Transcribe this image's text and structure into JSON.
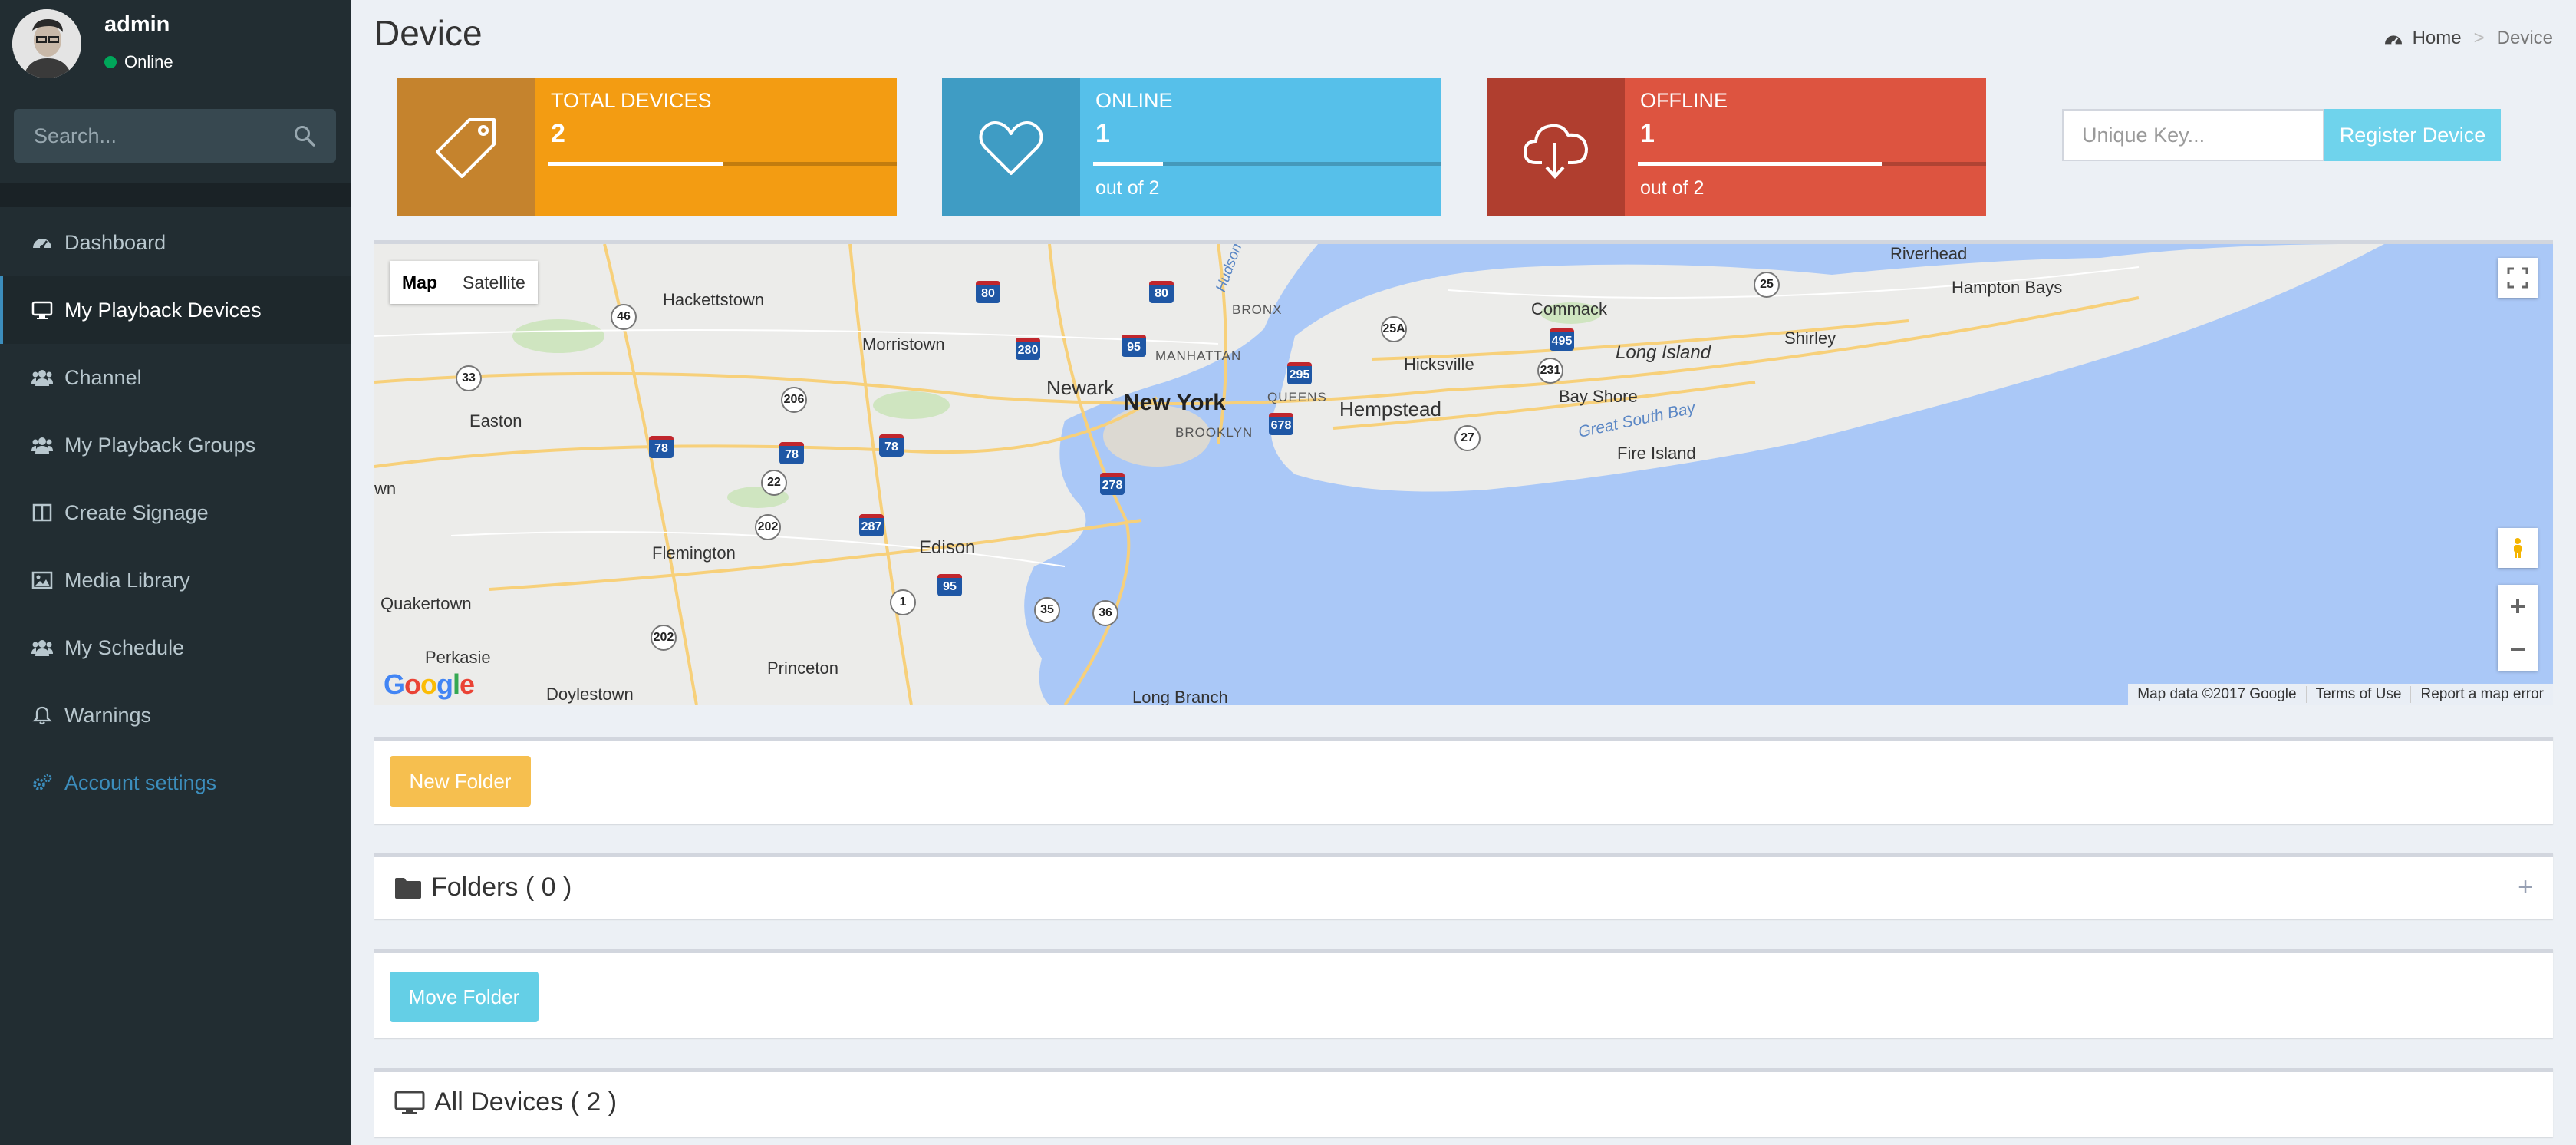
{
  "user": {
    "name": "admin",
    "status": "Online"
  },
  "search": {
    "placeholder": "Search..."
  },
  "nav": [
    {
      "label": "Dashboard",
      "icon": "dashboard-icon"
    },
    {
      "label": "My Playback Devices",
      "icon": "desktop-icon",
      "active": true
    },
    {
      "label": "Channel",
      "icon": "users-icon"
    },
    {
      "label": "My Playback Groups",
      "icon": "users-icon"
    },
    {
      "label": "Create Signage",
      "icon": "columns-icon"
    },
    {
      "label": "Media Library",
      "icon": "image-icon"
    },
    {
      "label": "My Schedule",
      "icon": "users-icon"
    },
    {
      "label": "Warnings",
      "icon": "bell-icon"
    },
    {
      "label": "Account settings",
      "icon": "gears-icon"
    }
  ],
  "page": {
    "title": "Device"
  },
  "breadcrumb": {
    "home": "Home",
    "current": "Device"
  },
  "stats": {
    "total": {
      "label": "TOTAL DEVICES",
      "value": "2",
      "progress": 0.5,
      "color": "#f39c12",
      "icon_bg": "#c5832d"
    },
    "online": {
      "label": "ONLINE",
      "value": "1",
      "sub": "out of 2",
      "progress": 0.2,
      "color": "#56c0ea",
      "icon_bg": "#3f9cc4"
    },
    "offline": {
      "label": "OFFLINE",
      "value": "1",
      "sub": "out of 2",
      "progress": 0.7,
      "color": "#dd5440",
      "icon_bg": "#b03e2f"
    }
  },
  "register": {
    "placeholder": "Unique Key...",
    "button": "Register Device"
  },
  "map": {
    "type_map": "Map",
    "type_satellite": "Satellite",
    "footer": [
      "Map data ©2017 Google",
      "Terms of Use",
      "Report a map error"
    ],
    "logo": "Google",
    "places": {
      "hackettstown": "Hackettstown",
      "morristown": "Morristown",
      "newark": "Newark",
      "newyork": "New York",
      "manhattan": "MANHATTAN",
      "bronx": "BRONX",
      "queens": "QUEENS",
      "brooklyn": "BROOKLYN",
      "hempstead": "Hempstead",
      "hicksville": "Hicksville",
      "commack": "Commack",
      "longisland": "Long Island",
      "bayshore": "Bay Shore",
      "greatsouthbay": "Great South Bay",
      "fireisland": "Fire Island",
      "shirley": "Shirley",
      "riverhead": "Riverhead",
      "hamptonbays": "Hampton Bays",
      "easton": "Easton",
      "flemington": "Flemington",
      "edison": "Edison",
      "quakertown": "Quakertown",
      "perkasie": "Perkasie",
      "princeton": "Princeton",
      "doylestown": "Doylestown",
      "longbranch": "Long Branch",
      "wn": "wn",
      "hudson": "Hudson"
    }
  },
  "actions": {
    "new_folder": "New Folder",
    "move_folder": "Move Folder"
  },
  "folders": {
    "title": "Folders ( 0 )",
    "toggle": "+"
  },
  "devices": {
    "title": "All Devices ( 2 )"
  }
}
